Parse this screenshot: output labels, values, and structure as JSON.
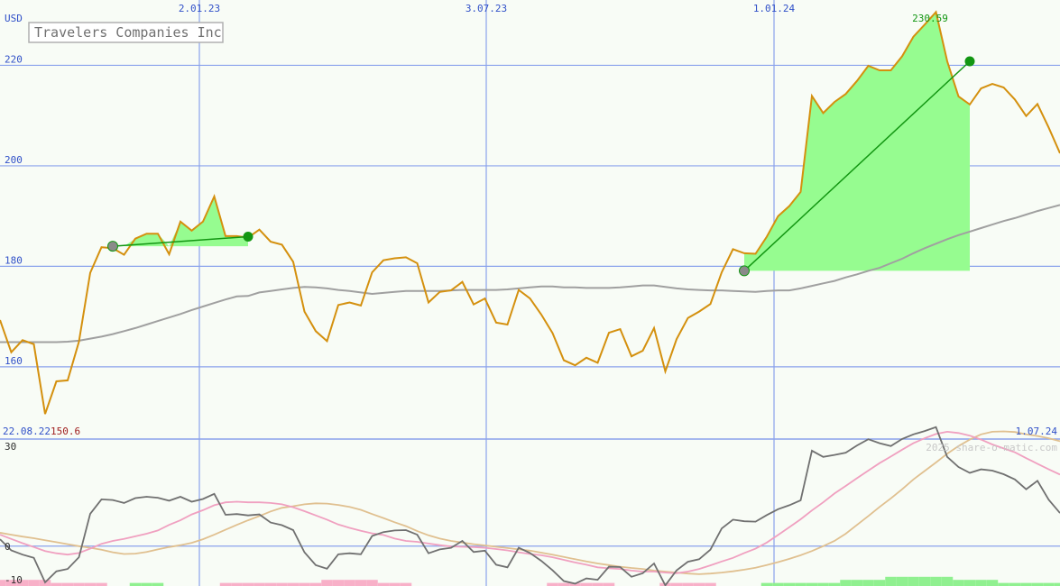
{
  "currency": "USD",
  "title": "Travelers Companies Inc",
  "watermark": "2025 share-o-matic.com",
  "colors": {
    "background": "#f8fcf6",
    "grid": "#8aa2ec",
    "axis_text": "#3050c8",
    "price_line": "#d4900e",
    "ma_line": "#a0a0a0",
    "trade_fill": "#96fc90",
    "trade_line": "#129612",
    "osc_dark": "#707070",
    "osc_pink": "#f0a0c0",
    "osc_tan": "#e0c090",
    "hist_pos": "#90f090",
    "hist_neg": "#f8b0c8",
    "high_label": "#129612",
    "low_label": "#a02020"
  },
  "chart_data": {
    "type": "line",
    "x_tick_labels": [
      "2.01.23",
      "3.07.23",
      "1.01.24"
    ],
    "y_tick_labels": [
      "220",
      "200",
      "180",
      "160"
    ],
    "y_ticks": [
      220,
      200,
      180,
      160
    ],
    "ylim": [
      145.8,
      233.0
    ],
    "date_range": [
      "22.08.22",
      "1.07.24"
    ],
    "low_label": "150.6",
    "high_label": "230.59",
    "grid": true,
    "series": [
      {
        "role": "price",
        "values": [
          169.3,
          162.9,
          165.3,
          164.5,
          150.6,
          157.1,
          157.3,
          165.0,
          178.7,
          183.8,
          183.6,
          182.3,
          185.5,
          186.5,
          186.5,
          182.4,
          188.9,
          187.1,
          188.9,
          193.9,
          186.0,
          186.0,
          185.7,
          187.3,
          184.9,
          184.3,
          180.9,
          171.0,
          167.1,
          165.1,
          172.3,
          172.8,
          172.2,
          178.8,
          181.2,
          181.6,
          181.8,
          180.6,
          172.8,
          174.9,
          175.2,
          176.9,
          172.4,
          173.6,
          168.8,
          168.4,
          175.3,
          173.6,
          170.4,
          166.7,
          161.3,
          160.3,
          161.8,
          160.8,
          166.8,
          167.5,
          162.1,
          163.2,
          167.7,
          159.1,
          165.5,
          169.7,
          171.0,
          172.5,
          178.8,
          183.4,
          182.6,
          182.5,
          185.9,
          190.0,
          192.0,
          194.8,
          213.9,
          210.5,
          212.7,
          214.3,
          216.9,
          219.9,
          219.0,
          219.0,
          221.8,
          225.7,
          228.1,
          230.6,
          220.8,
          213.8,
          212.2,
          215.4,
          216.3,
          215.6,
          213.2,
          209.9,
          212.3,
          207.6,
          202.5
        ]
      },
      {
        "role": "moving-average",
        "values": [
          164.9,
          164.9,
          164.9,
          164.9,
          164.9,
          164.9,
          165.0,
          165.2,
          165.6,
          166.0,
          166.5,
          167.1,
          167.7,
          168.4,
          169.1,
          169.8,
          170.5,
          171.3,
          172.0,
          172.7,
          173.4,
          174.0,
          174.1,
          174.8,
          175.1,
          175.4,
          175.7,
          175.9,
          175.8,
          175.6,
          175.3,
          175.1,
          174.8,
          174.5,
          174.7,
          174.9,
          175.1,
          175.1,
          175.1,
          175.1,
          175.2,
          175.3,
          175.3,
          175.3,
          175.3,
          175.4,
          175.6,
          175.8,
          176.0,
          176.0,
          175.8,
          175.8,
          175.7,
          175.7,
          175.7,
          175.8,
          176.0,
          176.2,
          176.2,
          175.9,
          175.6,
          175.4,
          175.3,
          175.2,
          175.2,
          175.1,
          175.0,
          174.9,
          175.1,
          175.2,
          175.2,
          175.6,
          176.1,
          176.6,
          177.1,
          177.8,
          178.4,
          179.1,
          179.7,
          180.6,
          181.5,
          182.6,
          183.6,
          184.5,
          185.4,
          186.2,
          186.9,
          187.6,
          188.3,
          189.0,
          189.6,
          190.3,
          191.0,
          191.6,
          192.2
        ]
      }
    ],
    "trades": [
      {
        "entry": 184.0,
        "exit": 185.9
      },
      {
        "entry": 179.1,
        "exit": 220.8
      }
    ],
    "oscillator": {
      "ylim": [
        -10,
        30
      ],
      "tick_labels": [
        "30",
        "0",
        "-10"
      ],
      "ticks": [
        30,
        0,
        -10
      ],
      "dark": [
        2.1,
        -1.3,
        -2.6,
        -3.6,
        -11.1,
        -7.7,
        -7.0,
        -3.4,
        9.9,
        14.3,
        14.1,
        13.2,
        14.7,
        15.1,
        14.8,
        13.9,
        15.1,
        13.6,
        14.4,
        16.0,
        9.6,
        9.8,
        9.4,
        9.7,
        7.2,
        6.4,
        4.9,
        -1.9,
        -5.8,
        -6.9,
        -2.5,
        -2.2,
        -2.5,
        3.1,
        4.3,
        4.8,
        4.9,
        3.5,
        -2.2,
        -1.0,
        -0.5,
        1.6,
        -1.8,
        -1.4,
        -5.7,
        -6.5,
        -0.5,
        -2.1,
        -4.5,
        -7.4,
        -10.7,
        -11.5,
        -9.9,
        -10.3,
        -6.3,
        -6.4,
        -9.4,
        -8.3,
        -5.3,
        -12.0,
        -7.4,
        -4.8,
        -4.0,
        -1.1,
        5.4,
        8.1,
        7.6,
        7.5,
        9.5,
        11.3,
        12.5,
        14.0,
        29.2,
        27.3,
        27.9,
        28.6,
        30.8,
        32.7,
        31.5,
        30.6,
        32.8,
        34.2,
        35.2,
        36.4,
        27.3,
        24.2,
        22.4,
        23.5,
        23.1,
        22.0,
        20.4,
        17.4,
        20.0,
        14.2,
        10.1
      ],
      "pink": [
        3.5,
        2.2,
        0.9,
        -0.3,
        -1.5,
        -2.2,
        -2.6,
        -2.1,
        -0.8,
        0.7,
        1.6,
        2.2,
        3.0,
        3.8,
        4.8,
        6.5,
        7.9,
        9.7,
        11.0,
        12.5,
        13.4,
        13.6,
        13.4,
        13.4,
        13.2,
        12.8,
        11.9,
        10.7,
        9.4,
        8.1,
        6.6,
        5.6,
        4.7,
        3.9,
        3.4,
        2.3,
        1.6,
        1.3,
        0.8,
        0.3,
        -0.1,
        -0.2,
        -0.3,
        -0.5,
        -0.9,
        -1.3,
        -1.9,
        -2.4,
        -2.8,
        -3.4,
        -4.2,
        -5.0,
        -5.7,
        -6.5,
        -6.8,
        -7.0,
        -7.5,
        -7.8,
        -7.8,
        -8.1,
        -8.3,
        -7.8,
        -7.0,
        -5.9,
        -4.7,
        -3.6,
        -2.1,
        -0.8,
        1.1,
        3.4,
        5.8,
        8.2,
        10.9,
        13.4,
        16.1,
        18.4,
        20.8,
        23.1,
        25.4,
        27.4,
        29.5,
        31.5,
        33.0,
        34.3,
        35.0,
        34.6,
        33.8,
        32.6,
        31.1,
        29.9,
        28.7,
        26.9,
        25.2,
        23.5,
        21.9
      ],
      "tan": [
        4.1,
        3.5,
        2.9,
        2.4,
        1.8,
        1.2,
        0.6,
        0.0,
        -0.5,
        -1.1,
        -1.9,
        -2.4,
        -2.3,
        -1.8,
        -1.0,
        -0.3,
        0.3,
        1.0,
        2.1,
        3.5,
        5.0,
        6.5,
        7.9,
        9.2,
        10.6,
        11.7,
        12.2,
        12.8,
        13.1,
        13.0,
        12.6,
        12.0,
        11.1,
        9.8,
        8.6,
        7.3,
        6.1,
        4.6,
        3.3,
        2.3,
        1.6,
        1.1,
        0.6,
        0.2,
        -0.2,
        -0.6,
        -1.0,
        -1.4,
        -2.0,
        -2.6,
        -3.3,
        -4.0,
        -4.7,
        -5.3,
        -5.8,
        -6.3,
        -6.7,
        -7.0,
        -7.5,
        -7.8,
        -8.1,
        -8.4,
        -8.6,
        -8.4,
        -8.1,
        -7.7,
        -7.2,
        -6.6,
        -5.8,
        -4.9,
        -3.9,
        -2.8,
        -1.5,
        0.0,
        1.6,
        3.8,
        6.5,
        9.2,
        12.0,
        14.6,
        17.4,
        20.4,
        23.0,
        25.6,
        28.3,
        30.6,
        32.6,
        34.2,
        35.0,
        35.1,
        34.9,
        34.2,
        33.7,
        33.0,
        32.1
      ],
      "histogram": [
        -3.4,
        -3.4,
        -3.4,
        -3.4,
        -3.4,
        -1.7,
        -1.7,
        -1.7,
        -1.7,
        -1.7,
        0.0,
        0.0,
        1.7,
        1.7,
        1.7,
        0.0,
        0.0,
        0.0,
        0.0,
        0.0,
        -1.7,
        -1.7,
        -1.7,
        -1.7,
        -1.7,
        -1.7,
        -1.7,
        -1.7,
        -1.7,
        -3.4,
        -3.4,
        -3.4,
        -3.4,
        -3.4,
        -1.7,
        -1.7,
        -1.7,
        0.0,
        0.0,
        0.0,
        0.0,
        0.0,
        0.0,
        0.0,
        0.0,
        0.0,
        0.0,
        0.0,
        0.0,
        -1.7,
        -1.7,
        -1.7,
        -1.7,
        -1.7,
        -1.7,
        0.0,
        0.0,
        0.0,
        0.0,
        -1.7,
        -1.7,
        -1.7,
        -1.7,
        -1.7,
        0.0,
        0.0,
        0.0,
        0.0,
        1.7,
        1.7,
        1.7,
        1.7,
        1.7,
        1.7,
        1.7,
        3.4,
        3.4,
        3.4,
        3.4,
        5.1,
        5.1,
        5.1,
        5.1,
        5.1,
        5.1,
        3.4,
        3.4,
        3.4,
        3.4,
        1.7,
        1.7,
        1.7,
        1.7,
        1.7,
        1.7
      ]
    }
  }
}
